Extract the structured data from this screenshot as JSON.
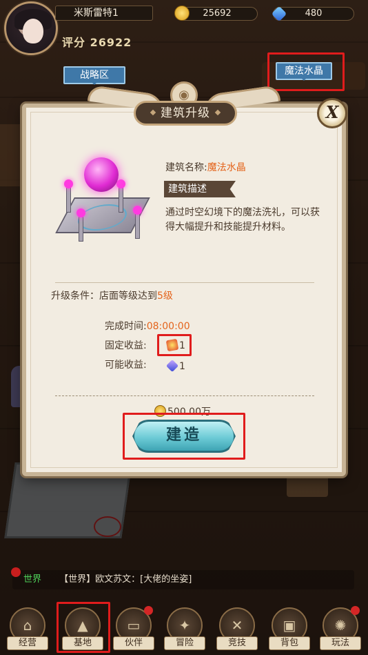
{
  "player": {
    "name": "米斯雷特1",
    "score_label": "评分",
    "score": "26922"
  },
  "resources": {
    "gold": "25692",
    "gems": "480"
  },
  "map_tags": {
    "strategy": "战略区",
    "crystal": "魔法水晶"
  },
  "dialog": {
    "title": "建筑升级",
    "close_label": "X",
    "name_label": "建筑名称:",
    "name_value": "魔法水晶",
    "desc_tag": "建筑描述",
    "description": "通过时空幻境下的魔法洗礼，可以获得大幅提升和技能提升材料。",
    "condition_label": "升级条件：店面等级达到",
    "condition_value": "5级",
    "time_label": "完成时间:",
    "time_value": "08:00:00",
    "fixed_label": "固定收益:",
    "fixed_value": "1",
    "possible_label": "可能收益:",
    "possible_value": "1",
    "price": "500.00万",
    "build_button": "建造"
  },
  "chat": {
    "channel": "世界",
    "message": "【世界】欧文苏文：[大佬的坐姿]"
  },
  "nav": {
    "items": [
      {
        "label": "经营",
        "icon": "shop-icon"
      },
      {
        "label": "基地",
        "icon": "tent-icon"
      },
      {
        "label": "伙伴",
        "icon": "cards-icon"
      },
      {
        "label": "冒险",
        "icon": "map-icon"
      },
      {
        "label": "竞技",
        "icon": "swords-icon"
      },
      {
        "label": "背包",
        "icon": "backpack-icon"
      },
      {
        "label": "玩法",
        "icon": "wheel-icon"
      }
    ]
  },
  "colors": {
    "highlight": "#e01c1c",
    "accent_orange": "#e4641c",
    "button_teal": "#6dcbd6"
  }
}
